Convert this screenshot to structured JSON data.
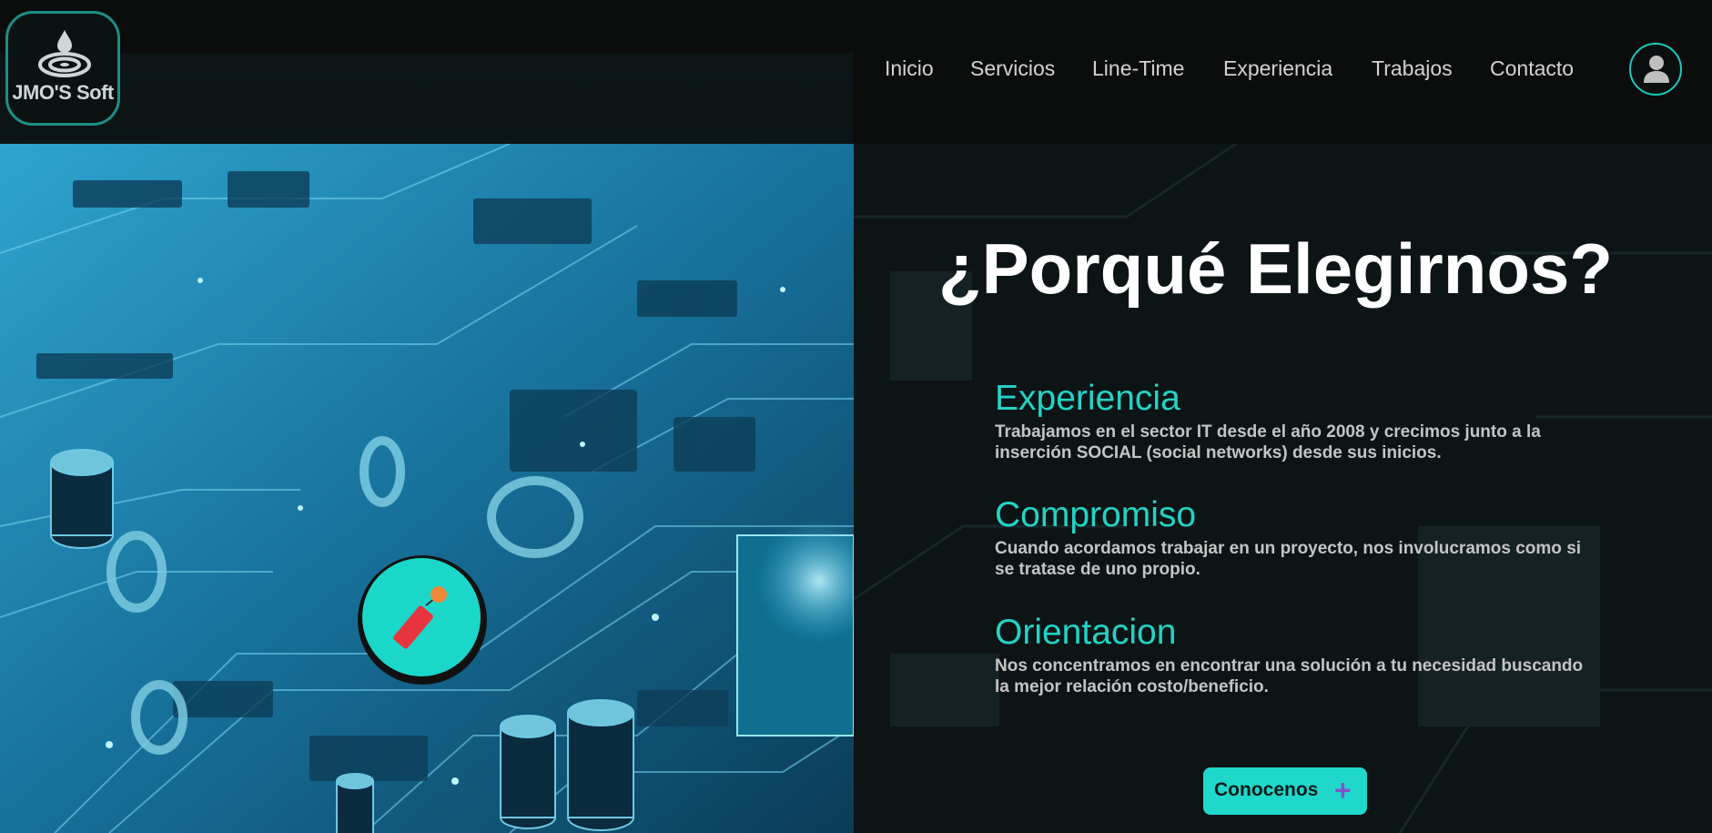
{
  "brand": {
    "logo_text": "JMO'S Soft",
    "logo_icon": "droplet-ripple-icon"
  },
  "nav": {
    "items": [
      {
        "label": "Inicio"
      },
      {
        "label": "Servicios"
      },
      {
        "label": "Line-Time"
      },
      {
        "label": "Experiencia"
      },
      {
        "label": "Trabajos"
      },
      {
        "label": "Contacto"
      }
    ],
    "user_icon": "user-icon"
  },
  "hero": {
    "image": "circuit-board-image",
    "badge_icon": "rocket-icon"
  },
  "section": {
    "title": "¿Porqué Elegirnos?",
    "items": [
      {
        "title": "Experiencia",
        "text": "Trabajamos en el sector IT desde el año 2008 y crecimos junto a la inserción SOCIAL (social networks) desde sus inicios."
      },
      {
        "title": "Compromiso",
        "text": "Cuando acordamos trabajar en un proyecto, nos involucramos como si se tratase de uno propio."
      },
      {
        "title": "Orientacion",
        "text": "Nos concentramos en encontrar una solución a tu necesidad buscando la mejor relación costo/beneficio."
      }
    ],
    "cta_label": "Conocenos",
    "cta_icon": "plus-icon"
  },
  "colors": {
    "accent": "#1fd8cb",
    "heading": "#ffffff",
    "item_title": "#23d3c5",
    "plus": "#7e55c9",
    "rocket": "#e8343f"
  }
}
